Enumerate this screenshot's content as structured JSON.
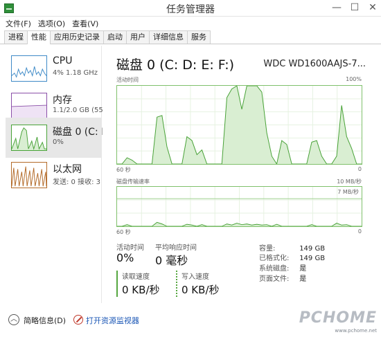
{
  "window": {
    "title": "任务管理器",
    "controls": {
      "minimize": "—",
      "maximize": "☐",
      "close": "✕"
    }
  },
  "menu": [
    "文件(F)",
    "选项(O)",
    "查看(V)"
  ],
  "tabs": [
    {
      "label": "进程",
      "active": false
    },
    {
      "label": "性能",
      "active": true
    },
    {
      "label": "应用历史记录",
      "active": false
    },
    {
      "label": "启动",
      "active": false
    },
    {
      "label": "用户",
      "active": false
    },
    {
      "label": "详细信息",
      "active": false
    },
    {
      "label": "服务",
      "active": false
    }
  ],
  "sidebar": {
    "items": [
      {
        "title": "CPU",
        "sub": "4% 1.18 GHz"
      },
      {
        "title": "内存",
        "sub": "1.1/2.0 GB (55"
      },
      {
        "title": "磁盘 0 (C: D",
        "sub": "0%",
        "selected": true
      },
      {
        "title": "以太网",
        "sub": "发送: 0 接收: 3"
      }
    ]
  },
  "main": {
    "disk_title": "磁盘 0 (C: D: E: F:)",
    "disk_model": "WDC WD1600AAJS-7...",
    "graph1": {
      "top_left": "活动时间",
      "top_right": "100%",
      "bottom_left": "60 秒",
      "bottom_right": "0",
      "values": [
        0,
        0,
        8,
        5,
        0,
        0,
        0,
        0,
        60,
        62,
        22,
        0,
        0,
        0,
        35,
        30,
        12,
        18,
        0,
        0,
        0,
        0,
        85,
        96,
        100,
        70,
        100,
        100,
        100,
        92,
        40,
        10,
        0,
        30,
        25,
        0,
        0,
        0,
        0,
        28,
        30,
        10,
        0,
        0,
        10,
        75,
        35,
        20,
        0,
        0
      ]
    },
    "graph2": {
      "top_left": "磁盘传输速率",
      "top_right": "10 MB/秒",
      "inner_label": "7 MB/秒",
      "bottom_left": "60 秒",
      "bottom_right": "0",
      "values": [
        0,
        0,
        0.4,
        0,
        0,
        0,
        0,
        0,
        1.0,
        0.6,
        0,
        0,
        0,
        0,
        0.5,
        0.3,
        0,
        0.4,
        0,
        0,
        0,
        0,
        0.6,
        0.3,
        0.8,
        0.4,
        0.6,
        0.3,
        0.5,
        0.3,
        0.4,
        0,
        0.5,
        0,
        0,
        0,
        0,
        0,
        0,
        0.4,
        0,
        0,
        0,
        0,
        0.8,
        0.3,
        0.4,
        0,
        0,
        0
      ]
    },
    "stats": {
      "active_time_label": "活动时间",
      "active_time_value": "0%",
      "avg_response_label": "平均响应时间",
      "avg_response_value": "0 毫秒",
      "read_label": "读取速度",
      "read_value": "0 KB/秒",
      "write_label": "写入速度",
      "write_value": "0 KB/秒"
    },
    "details": [
      {
        "key": "容量:",
        "value": "149 GB"
      },
      {
        "key": "已格式化:",
        "value": "149 GB"
      },
      {
        "key": "系统磁盘:",
        "value": "是"
      },
      {
        "key": "页面文件:",
        "value": "是"
      }
    ]
  },
  "bottom": {
    "summary_label": "简略信息(D)",
    "resmon_label": "打开资源监视器"
  },
  "watermark": {
    "text": "PCHOME",
    "url": "www.pchome.net"
  },
  "colors": {
    "disk_green": "#48a237",
    "graph_fill": "#d9eed2",
    "cpu_blue": "#3e8ac7",
    "mem_purple": "#8a4fa8",
    "eth_orange": "#b36a28"
  }
}
